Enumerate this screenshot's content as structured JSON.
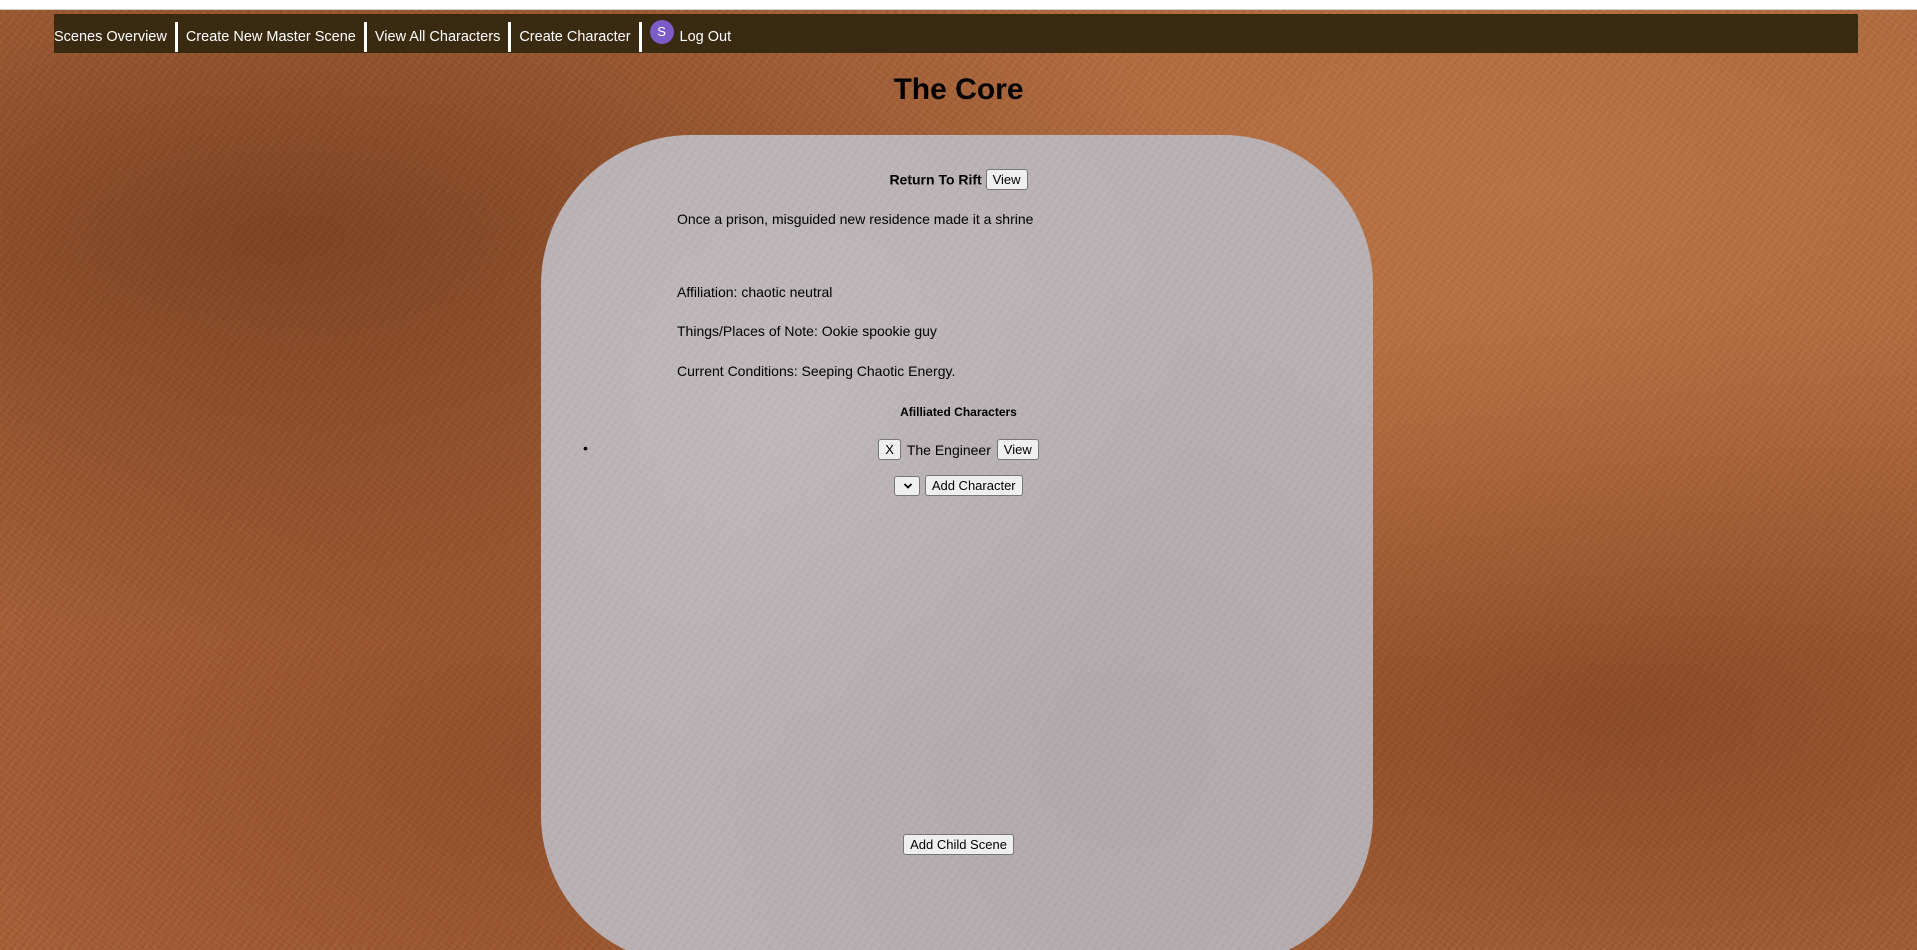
{
  "nav": {
    "items": [
      {
        "label": "Scenes Overview"
      },
      {
        "label": "Create New Master Scene"
      },
      {
        "label": "View All Characters"
      },
      {
        "label": "Create Character"
      }
    ],
    "avatar_initial": "S",
    "logout_label": "Log Out"
  },
  "page": {
    "title": "The Core"
  },
  "scene": {
    "parent_label": "Return To Rift",
    "parent_view_label": "View",
    "description": "Once a prison, misguided new residence made it a shrine",
    "affiliation": "Affiliation: chaotic neutral",
    "things_of_note": "Things/Places of Note: Ookie spookie guy",
    "current_conditions": "Current Conditions: Seeping Chaotic Energy."
  },
  "characters": {
    "heading": "Afilliated Characters",
    "items": [
      {
        "remove_label": "X",
        "name": "The Engineer",
        "view_label": "View"
      }
    ],
    "select_value": "",
    "add_label": "Add Character"
  },
  "child": {
    "add_label": "Add Child Scene"
  },
  "colors": {
    "navbar": "#3a2a12",
    "card": "#b8b0b2",
    "avatar": "#7b5cc8"
  }
}
